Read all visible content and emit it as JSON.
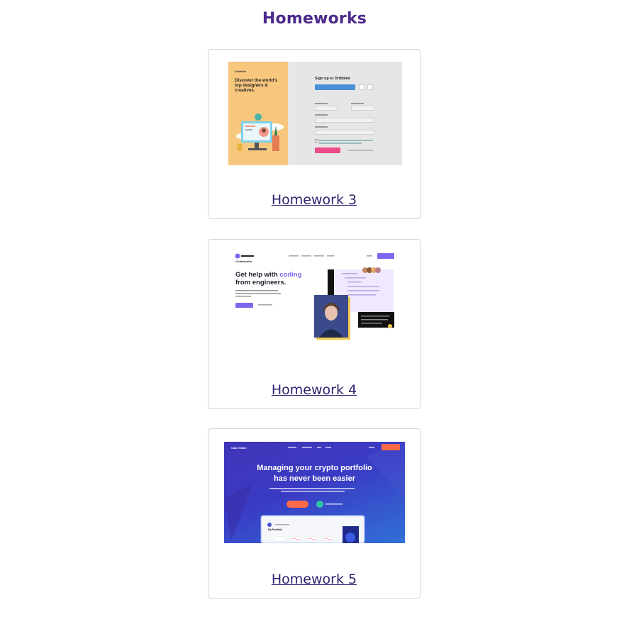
{
  "page": {
    "title": "Homeworks"
  },
  "cards": [
    {
      "link": "Homework 3",
      "thumb": {
        "brand": "Dribbble",
        "headline": "Discover the world's top designers & creatives.",
        "form_title": "Sign up to Dribbble",
        "accent": "#f7c77e",
        "button_color": "#ea4c89"
      }
    },
    {
      "link": "Homework 4",
      "thumb": {
        "brand": "Codementor",
        "headline_prefix": "Get help with ",
        "headline_highlight": "coding",
        "headline_suffix": "from engineers.",
        "accent": "#7b68ee"
      }
    },
    {
      "link": "Homework 5",
      "thumb": {
        "brand": "Cash Stake",
        "headline_line1": "Managing your crypto portfolio",
        "headline_line2": "has never been easier",
        "dashboard_title": "My Portfolio",
        "accent": "#ff6b4a",
        "background": "#3a3bc4"
      }
    }
  ]
}
